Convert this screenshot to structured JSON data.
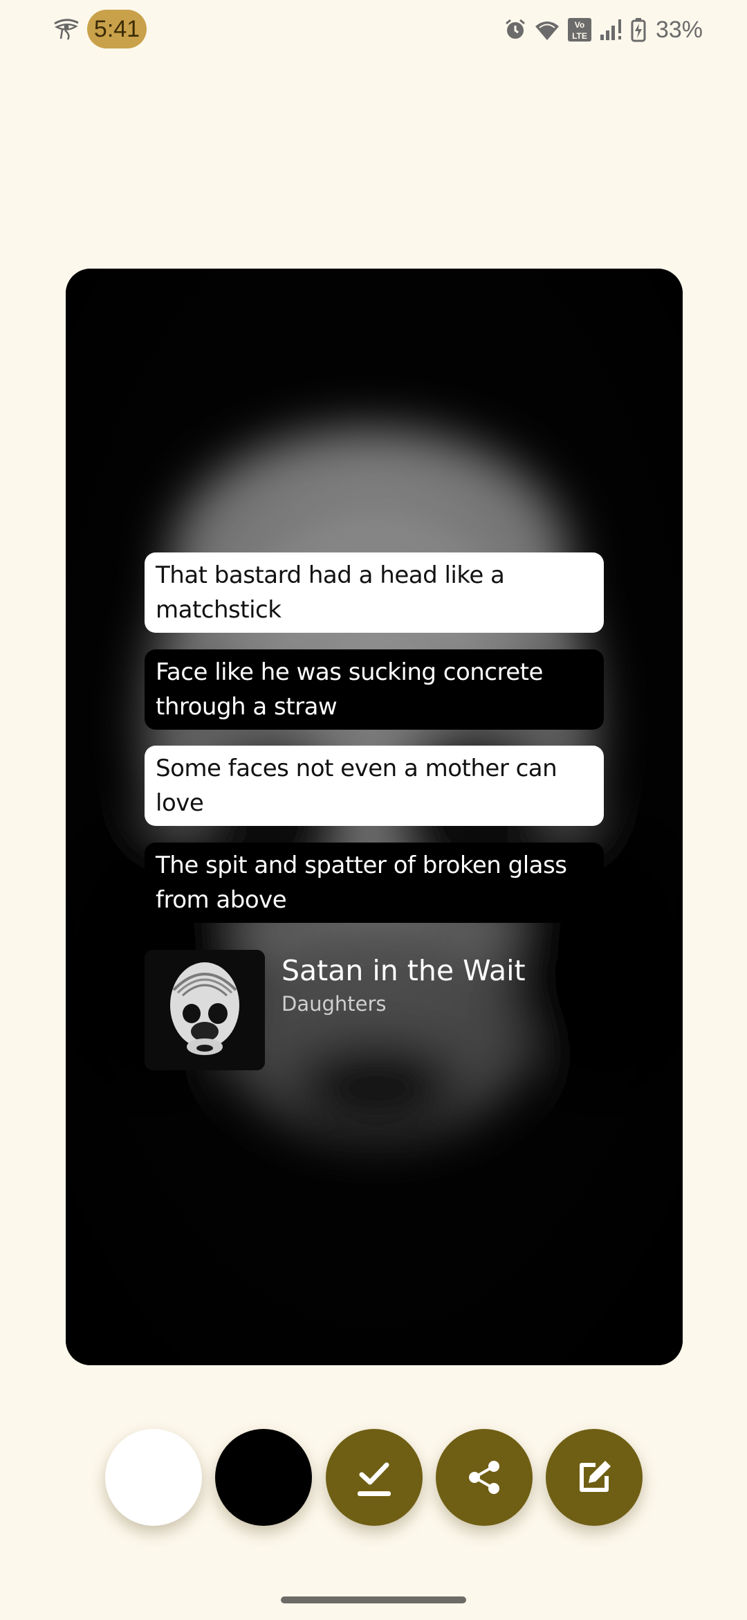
{
  "status_bar": {
    "time": "5:41",
    "battery_percent": "33%",
    "icons": [
      "eye-of-horus-icon",
      "alarm-icon",
      "wifi-icon",
      "volte-icon",
      "signal-icon",
      "battery-charging-icon"
    ]
  },
  "colors": {
    "background": "#fdf8ec",
    "accent": "#6f5f14",
    "time_chip": "#c9a14a"
  },
  "lyrics": [
    {
      "text": "That bastard had a head like a matchstick",
      "style": "light"
    },
    {
      "text": "Face like he was sucking concrete through a straw",
      "style": "dark"
    },
    {
      "text": "Some faces not even a mother can love",
      "style": "light"
    },
    {
      "text": "The spit and spatter of broken glass from above",
      "style": "dark"
    }
  ],
  "song": {
    "title": "Satan in the Wait",
    "artist": "Daughters"
  },
  "actions": [
    {
      "name": "white-background-option",
      "icon": "white-circle"
    },
    {
      "name": "black-background-option",
      "icon": "black-circle"
    },
    {
      "name": "save",
      "icon": "check-icon"
    },
    {
      "name": "share",
      "icon": "share-icon"
    },
    {
      "name": "edit",
      "icon": "edit-icon"
    }
  ]
}
